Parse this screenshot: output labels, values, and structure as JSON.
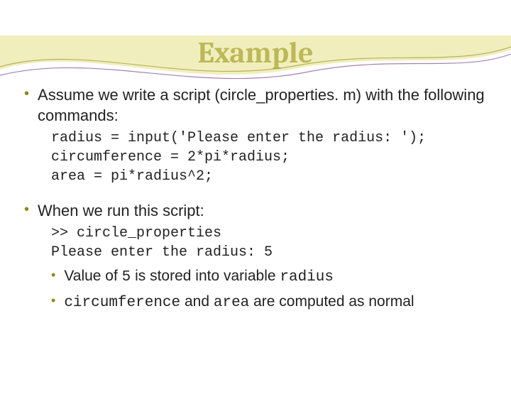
{
  "title": "Example",
  "bullets": [
    {
      "text": "Assume we write a script (circle_properties. m) with the following commands:",
      "code": "radius = input('Please enter the radius: ');\ncircumference = 2*pi*radius;\narea = pi*radius^2;"
    },
    {
      "text": "When we run this script:",
      "code": ">> circle_properties\nPlease enter the radius: 5",
      "sub": [
        {
          "pre": "Value of ",
          "mono1": "5",
          "mid": " is stored into variable ",
          "mono2": "radius",
          "post": ""
        },
        {
          "pre": "",
          "mono1": "circumference",
          "mid": " and ",
          "mono2": "area",
          "post": " are computed as normal"
        }
      ]
    }
  ]
}
